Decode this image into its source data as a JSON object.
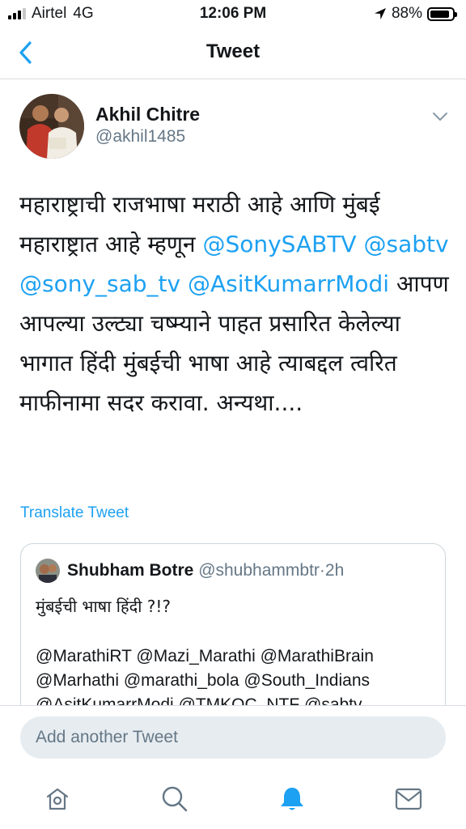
{
  "status_bar": {
    "carrier": "Airtel",
    "network": "4G",
    "time": "12:06 PM",
    "battery_percent": "88%",
    "battery_level": 0.88
  },
  "nav": {
    "title": "Tweet",
    "back_icon": "chevron-left-icon"
  },
  "tweet": {
    "author_name": "Akhil Chitre",
    "author_handle": "@akhil1485",
    "body": {
      "part1": "महाराष्ट्राची राजभाषा मराठी आहे आणि मुंबई महाराष्ट्रात आहे म्हणून ",
      "mention1": "@SonySABTV",
      "mention2": "@sabtv",
      "mention3": "@sony_sab_tv",
      "mention4": "@AsitKumarrModi",
      "part2": " आपण आपल्या उल्ट्या चष्म्याने पाहत प्रसारित केलेल्या भागात हिंदी मुंबईची भाषा आहे त्याबद्दल त्वरित माफीनामा सदर करावा. अन्यथा...."
    },
    "translate_label": "Translate Tweet"
  },
  "quoted_tweet": {
    "author_name": "Shubham Botre",
    "author_handle": "@shubhammbtr",
    "separator": "·",
    "age": "2h",
    "text": "मुंबईची भाषा हिंदी ?!?",
    "mentions": "@MarathiRT @Mazi_Marathi @MarathiBrain @Marhathi @marathi_bola @South_Indians @AsitKumarrModi @TMKOC_NTF @sabtv"
  },
  "compose": {
    "placeholder": "Add another Tweet"
  },
  "tab_bar": {
    "items": [
      {
        "icon": "home-icon",
        "active": false
      },
      {
        "icon": "search-icon",
        "active": false
      },
      {
        "icon": "bell-icon",
        "active": true
      },
      {
        "icon": "mail-icon",
        "active": false
      }
    ]
  },
  "colors": {
    "accent": "#1da1f2",
    "text": "#14171a",
    "secondary_text": "#657786",
    "divider": "#d8dde1",
    "compose_bg": "#e6ecf0"
  }
}
